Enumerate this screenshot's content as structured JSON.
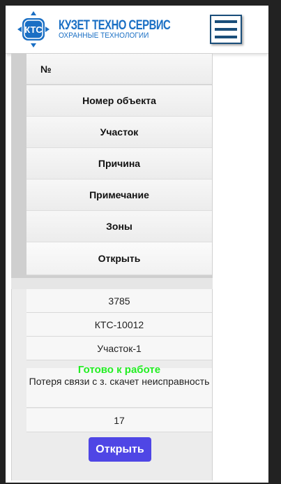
{
  "header": {
    "brand_name": "КУЗЕТ ТЕХНО СЕРВИС",
    "brand_tagline": "ОХРАННЫЕ ТЕХНОЛОГИИ",
    "logo_mark": "КТС"
  },
  "table": {
    "headers": [
      "№",
      "Номер объекта",
      "Участок",
      "Причина",
      "Примечание",
      "Зоны",
      "Открыть"
    ],
    "row": {
      "number": "3785",
      "object_number": "КТС-10012",
      "area": "Участок-1",
      "status": "Готово к работе",
      "note": "Потеря связи с з. скачет неисправность",
      "zones": "17",
      "open_label": "Открыть"
    }
  },
  "colors": {
    "brand": "#1a6fc4",
    "status": "#22ee22",
    "button": "#4f46e5"
  }
}
